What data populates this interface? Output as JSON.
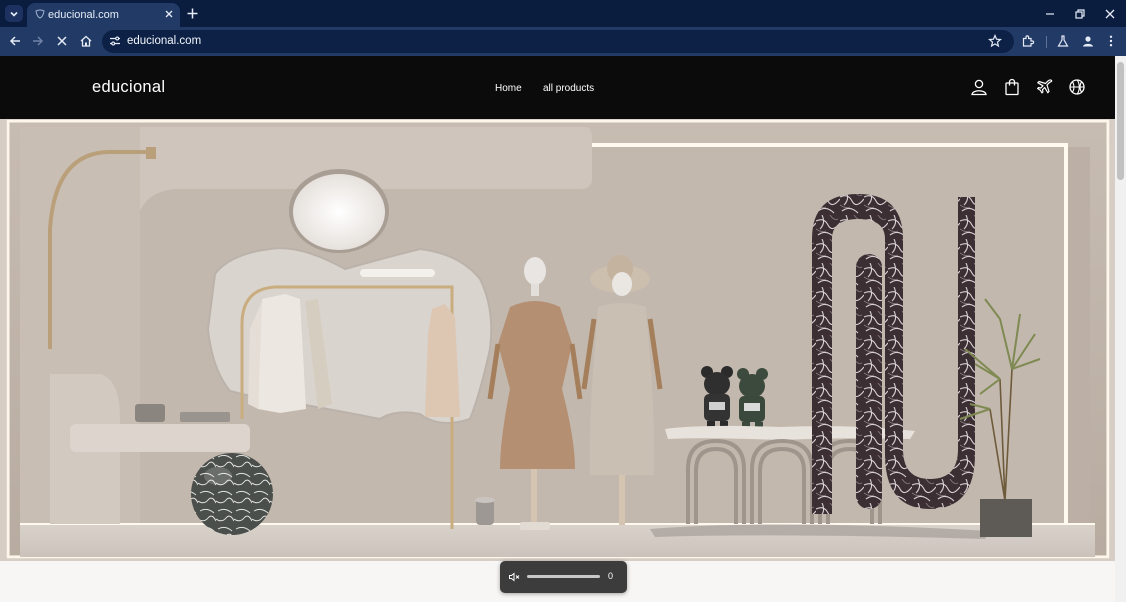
{
  "browser": {
    "tab_title": "educional.com",
    "url": "educional.com"
  },
  "site": {
    "logo": "educional",
    "nav": [
      "Home",
      "all products"
    ]
  },
  "media": {
    "volume": "0"
  },
  "colors": {
    "header_bg": "#0b0b0b",
    "chrome_dark": "#0b1d3f",
    "chrome_light": "#223a66"
  }
}
